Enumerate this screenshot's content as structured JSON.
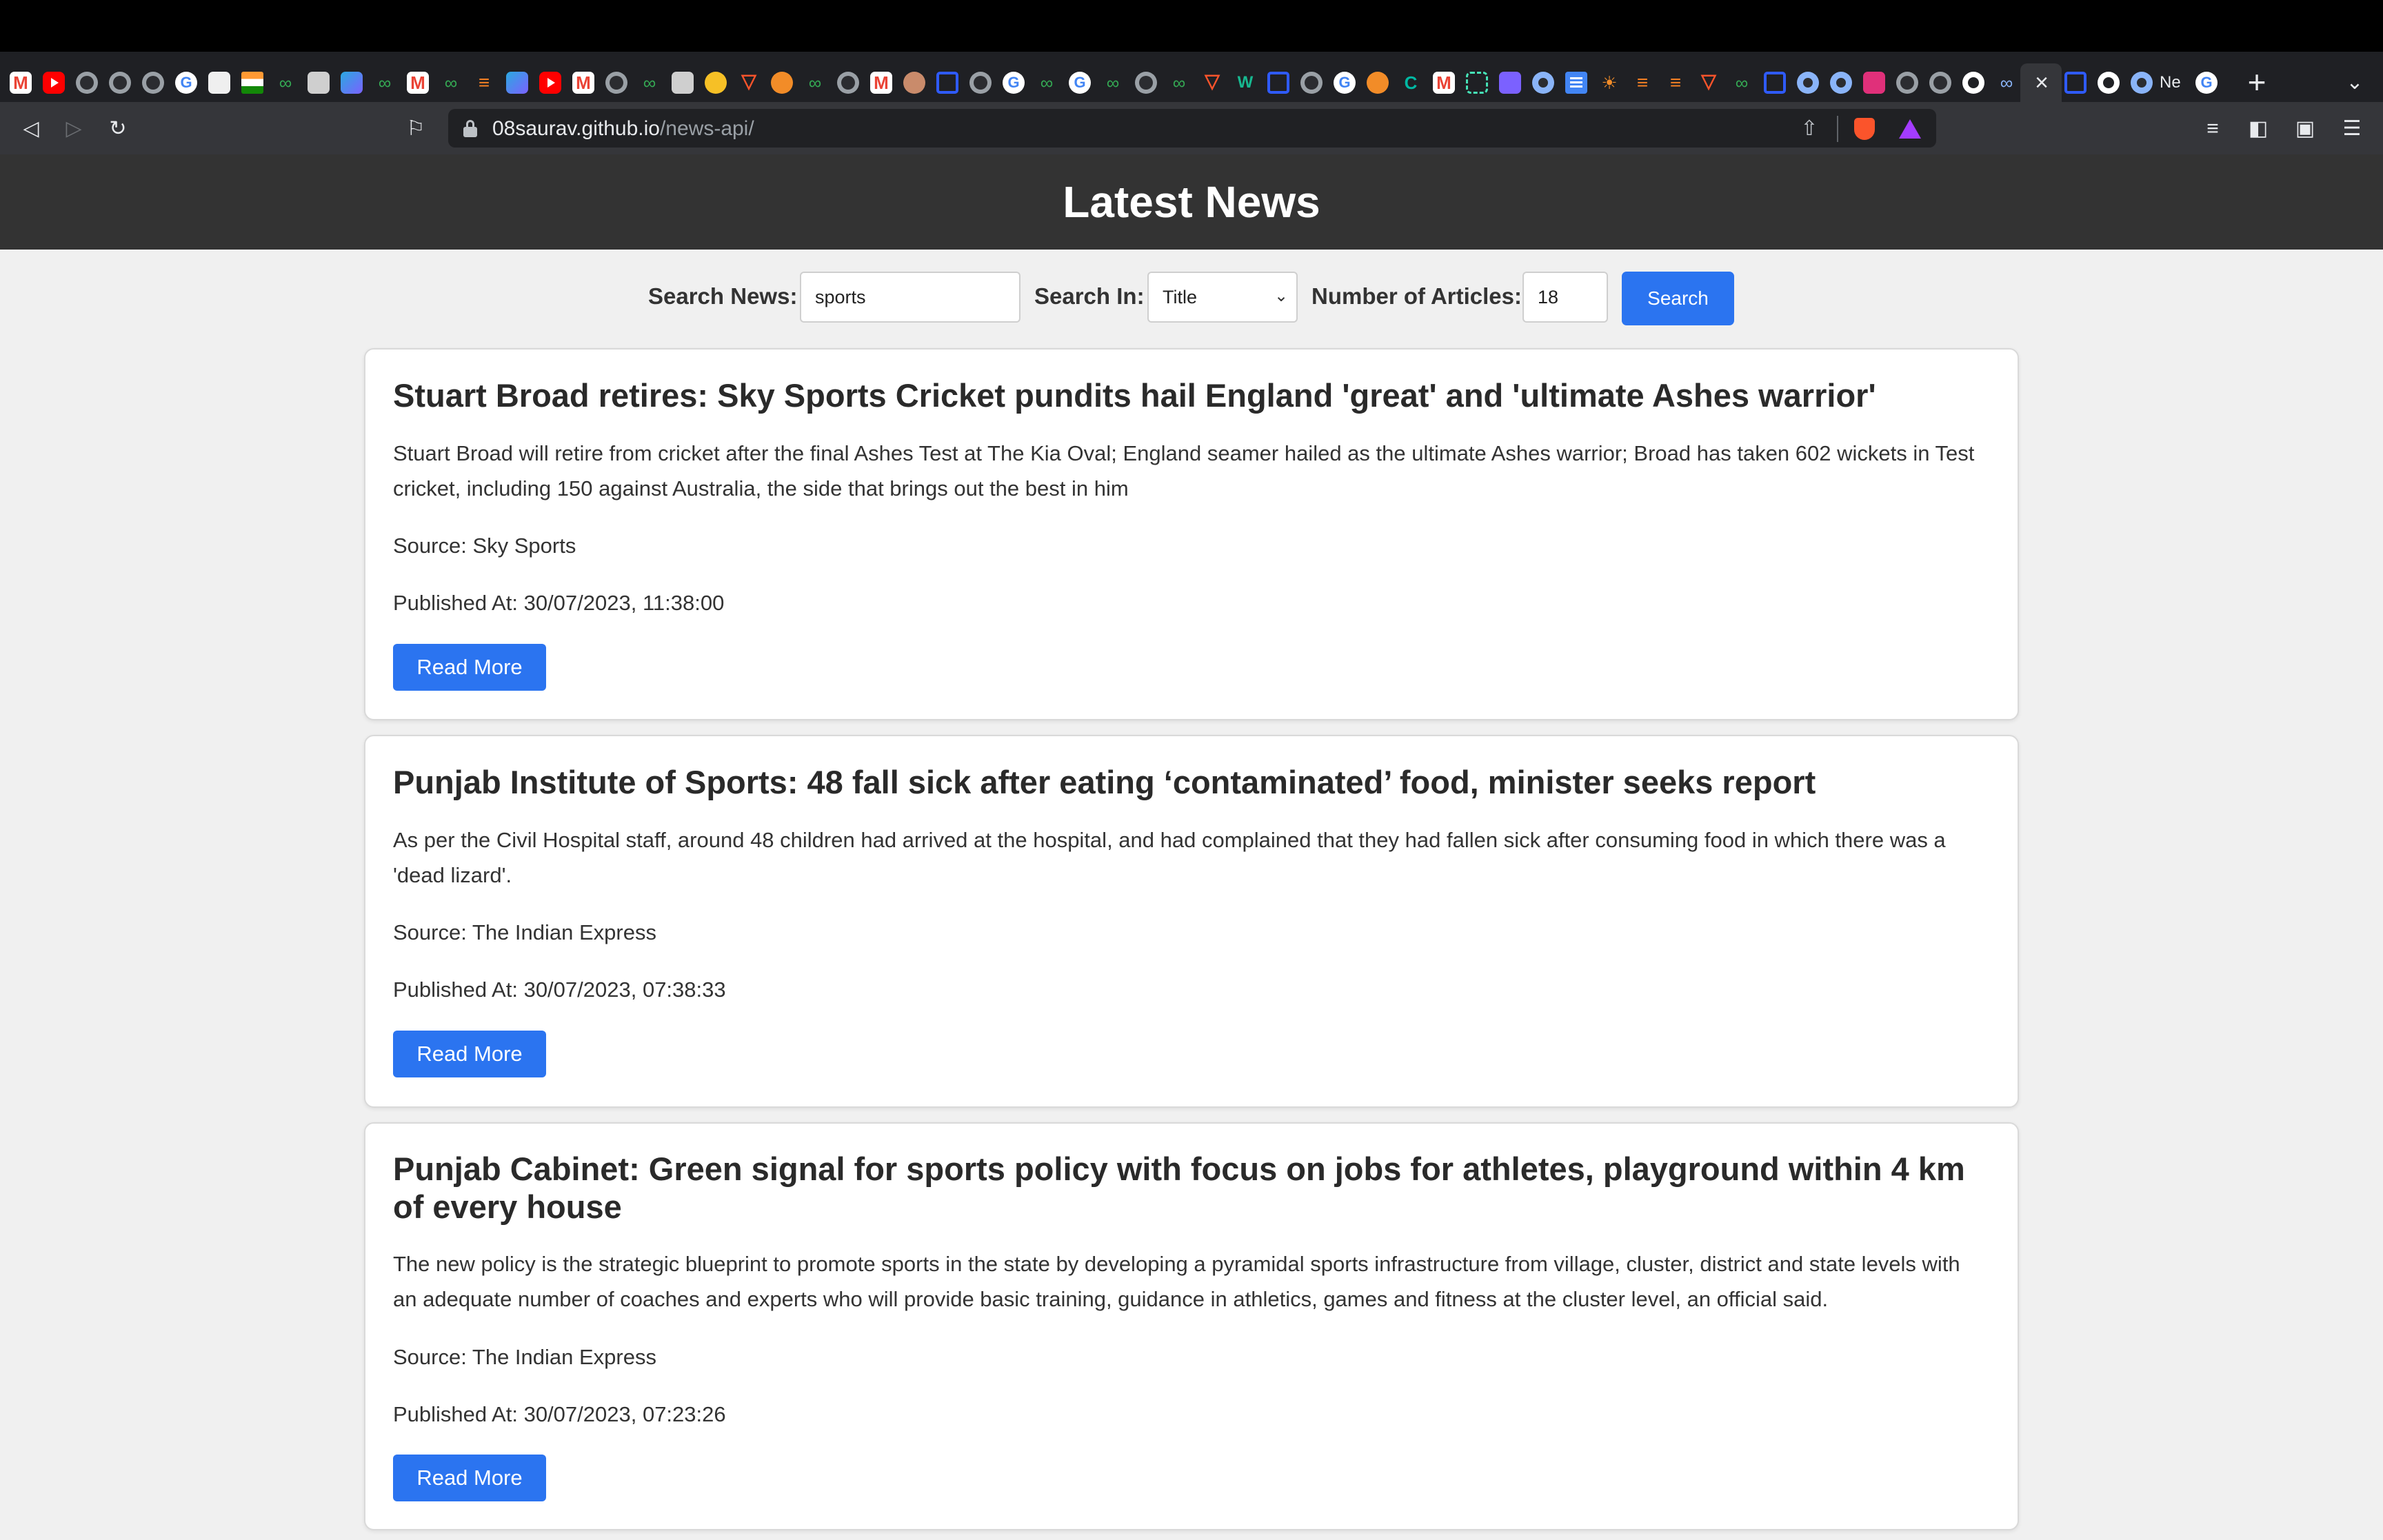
{
  "browser": {
    "tab_overflow_text": "Ne",
    "close_tab_glyph": "×",
    "new_tab_glyph": "+",
    "tab_menu_glyph": "⌄",
    "tab_icons": [
      "gmail-icon",
      "youtube-icon",
      "globe-icon",
      "globe-icon",
      "google-icon",
      "note-icon",
      "india-flag-icon",
      "infinity-icon",
      "bot-icon",
      "bluegrad-icon",
      "infinity-icon",
      "gmail-icon",
      "infinity-icon",
      "stackoverflow-icon",
      "bluegrad-icon",
      "youtube-icon",
      "gmail-icon",
      "globe-icon",
      "infinity-icon",
      "bot-icon",
      "yellow-icon",
      "brave-icon",
      "pencil-icon",
      "infinity-icon",
      "globe-icon",
      "gmail-icon",
      "avatar-icon",
      "bluesq-icon",
      "globe-icon",
      "google-icon",
      "infinity-icon",
      "google-icon",
      "infinity-icon",
      "globe-icon",
      "infinity-icon",
      "brave-icon",
      "w-icon",
      "bluesq-icon",
      "globe-icon",
      "google-icon",
      "orange-icon",
      "leetcode-icon",
      "gmail-icon",
      "dashed-icon",
      "purple-icon",
      "ring-icon",
      "docs-icon",
      "sun-icon",
      "stackoverflow-icon",
      "brave-icon",
      "brave-icon",
      "infinity-icon",
      "bluesq-icon",
      "ring-icon",
      "ring-icon",
      "pink-icon",
      "globe-icon",
      "github-icon",
      "link-icon"
    ],
    "url_domain": "08saurav.github.io",
    "url_path": "/news-api/",
    "brand_color": "#fb542b"
  },
  "header": {
    "title": "Latest News"
  },
  "search": {
    "label_query": "Search News:",
    "query_value": "sports",
    "label_search_in": "Search In:",
    "search_in_value": "Title",
    "label_count": "Number of Articles:",
    "count_value": "18",
    "button_label": "Search"
  },
  "articles": [
    {
      "title": "Stuart Broad retires: Sky Sports Cricket pundits hail England 'great' and 'ultimate Ashes warrior'",
      "description": "Stuart Broad will retire from cricket after the final Ashes Test at The Kia Oval; England seamer hailed as the ultimate Ashes warrior; Broad has taken 602 wickets in Test cricket, including 150 against Australia, the side that brings out the best in him",
      "source": "Source: Sky Sports",
      "published": "Published At: 30/07/2023, 11:38:00",
      "read_more_label": "Read More"
    },
    {
      "title": "Punjab Institute of Sports: 48 fall sick after eating ‘contaminated’ food, minister seeks report",
      "description": "As per the Civil Hospital staff, around 48 children had arrived at the hospital, and had complained that they had fallen sick after consuming food in which there was a 'dead lizard'.",
      "source": "Source: The Indian Express",
      "published": "Published At: 30/07/2023, 07:38:33",
      "read_more_label": "Read More"
    },
    {
      "title": "Punjab Cabinet: Green signal for sports policy with focus on jobs for athletes, playground within 4 km of every house",
      "description": "The new policy is the strategic blueprint to promote sports in the state by developing a pyramidal sports infrastructure from village, cluster, district and state levels with an adequate number of coaches and experts who will provide basic training, guidance in athletics, games and fitness at the cluster level, an official said.",
      "source": "Source: The Indian Express",
      "published": "Published At: 30/07/2023, 07:23:26",
      "read_more_label": "Read More"
    }
  ],
  "colors": {
    "header_bg": "#333333",
    "button_bg": "#2b74f0",
    "page_bg": "#f0f0f0"
  }
}
